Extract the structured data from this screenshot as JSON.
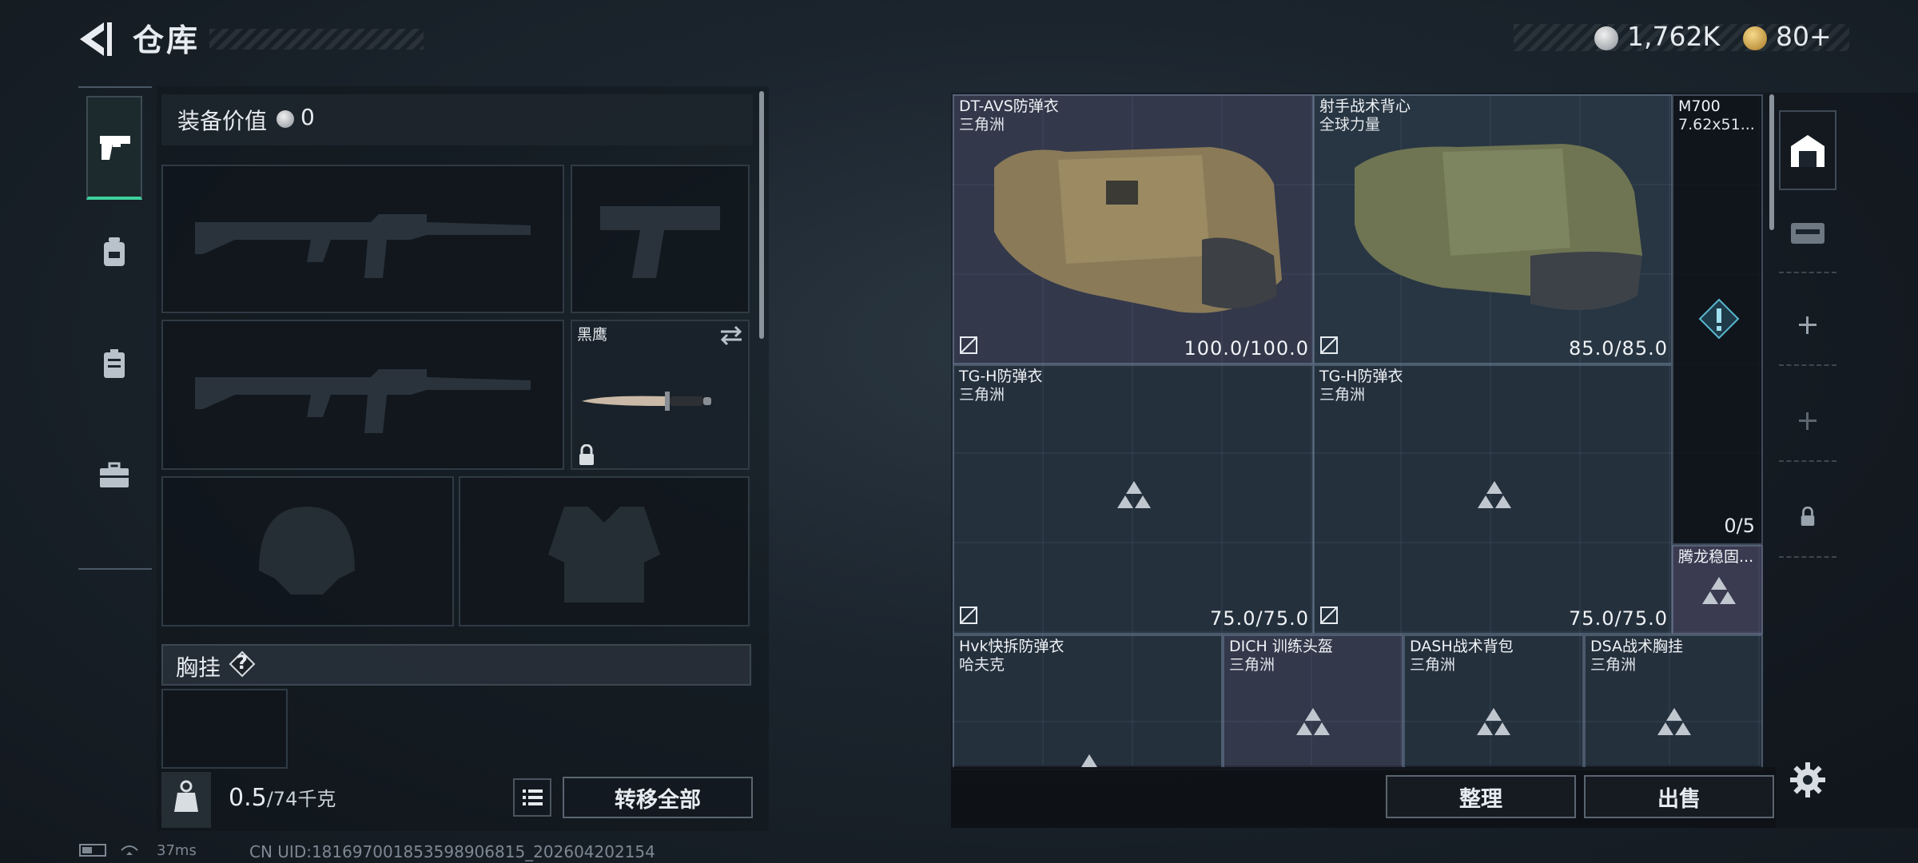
{
  "header": {
    "title": "仓库",
    "currency_silver": "1,762K",
    "currency_gold": "80+"
  },
  "equipment": {
    "value_label": "装备价值",
    "value": "0",
    "melee_name": "黑鹰",
    "chest_rig_label": "胸挂",
    "help_glyph": "?",
    "weight_value": "0.5",
    "weight_unit": "/74千克",
    "transfer_all": "转移全部"
  },
  "storage": {
    "items": [
      {
        "name": "DT-AVS防弹衣",
        "maker": "三角洲",
        "durability": "100.0/100.0"
      },
      {
        "name": "射手战术背心",
        "maker": "全球力量",
        "durability": "85.0/85.0"
      },
      {
        "name": "TG-H防弹衣",
        "maker": "三角洲",
        "durability": "75.0/75.0"
      },
      {
        "name": "TG-H防弹衣",
        "maker": "三角洲",
        "durability": "75.0/75.0"
      },
      {
        "name": "M700",
        "maker": "7.62x51...",
        "count": "0/5"
      },
      {
        "name": "腾龙稳固..."
      },
      {
        "name": "Hvk快拆防弹衣",
        "maker": "哈夫克"
      },
      {
        "name": "DICH 训练头盔",
        "maker": "三角洲"
      },
      {
        "name": "DASH战术背包",
        "maker": "三角洲"
      },
      {
        "name": "DSA战术胸挂",
        "maker": "三角洲"
      }
    ],
    "organize": "整理",
    "sell": "出售"
  },
  "status": {
    "ping": "37ms",
    "uid": "CN UID:1816970018535989068​15_202604202154"
  },
  "colors": {
    "accent_green": "#3ed19c",
    "rarity_purple": "#5a5073",
    "rarity_blue": "#3c4e64"
  }
}
